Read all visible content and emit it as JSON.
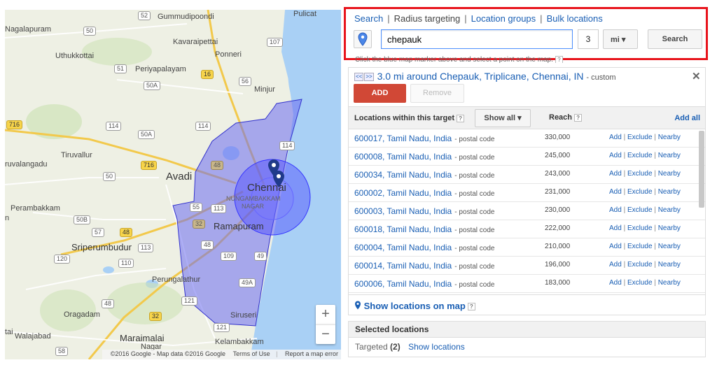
{
  "map": {
    "labels": {
      "pulicat": "Pulicat",
      "gummudipoondi": "Gummudipoondi",
      "nagalapuram": "Nagalapuram",
      "kavaraipettai": "Kavaraipettai",
      "uthukkottai": "Uthukkottai",
      "ponneri": "Ponneri",
      "periyapalayam": "Periyapalayam",
      "minjur": "Minjur",
      "tiruvallur": "Tiruvallur",
      "ruvalangadu": "ruvalangadu",
      "avadi": "Avadi",
      "chennai": "Chennai",
      "nungambakkam": "NUNGAMBAKKAM",
      "nagar": "NAGAR",
      "perambakkam": "Perambakkam",
      "ramapuram": "Ramapuram",
      "sriperumbudur": "Sriperumbudur",
      "perungalathur": "Perungalathur",
      "oragadam": "Oragadam",
      "siruseri": "Siruseri",
      "walajabad": "Walajabad",
      "tai": "tai",
      "maraimalai": "Maraimalai",
      "maraimalai_nagar": "Nagar",
      "kelambakkam": "Kelambakkam",
      "n_left": "n"
    },
    "shields": [
      "52",
      "50",
      "107",
      "51",
      "16",
      "56",
      "50A",
      "716",
      "114",
      "50A",
      "114",
      "48",
      "716",
      "50",
      "114",
      "55",
      "113",
      "32",
      "50B",
      "57",
      "48",
      "48",
      "113",
      "120",
      "110",
      "109",
      "49",
      "49A",
      "48",
      "121",
      "32",
      "121",
      "58"
    ],
    "zoom_in": "+",
    "zoom_out": "−",
    "footer": {
      "copyright": "©2016 Google - Map data ©2016 Google",
      "terms": "Terms of Use",
      "report": "Report a map error"
    },
    "colors": {
      "region_fill": "#6b6bf0",
      "region_stroke": "#3333cc",
      "radius_fill": "#4a4aff"
    }
  },
  "search": {
    "tabs": {
      "search": "Search",
      "radius": "Radius targeting",
      "groups": "Location groups",
      "bulk": "Bulk locations"
    },
    "location_value": "chepauk",
    "radius_value": "3",
    "unit": "mi ▾",
    "button": "Search",
    "hint": "Click the blue map marker above and select a point on the map."
  },
  "target": {
    "prev": "<<",
    "next": ">>",
    "title": "3.0 mi around Chepauk, Triplicane, Chennai, IN",
    "custom": "- custom",
    "close": "✕",
    "add": "ADD",
    "remove": "Remove"
  },
  "locations": {
    "header": "Locations within this target",
    "show_all": "Show all ▾",
    "reach_header": "Reach",
    "add_all": "Add all",
    "help": "?",
    "rows": [
      {
        "name": "600017, Tamil Nadu, India",
        "type": "- postal code",
        "reach": "330,000"
      },
      {
        "name": "600008, Tamil Nadu, India",
        "type": "- postal code",
        "reach": "245,000"
      },
      {
        "name": "600034, Tamil Nadu, India",
        "type": "- postal code",
        "reach": "243,000"
      },
      {
        "name": "600002, Tamil Nadu, India",
        "type": "- postal code",
        "reach": "231,000"
      },
      {
        "name": "600003, Tamil Nadu, India",
        "type": "- postal code",
        "reach": "230,000"
      },
      {
        "name": "600018, Tamil Nadu, India",
        "type": "- postal code",
        "reach": "222,000"
      },
      {
        "name": "600004, Tamil Nadu, India",
        "type": "- postal code",
        "reach": "210,000"
      },
      {
        "name": "600014, Tamil Nadu, India",
        "type": "- postal code",
        "reach": "196,000"
      },
      {
        "name": "600006, Tamil Nadu, India",
        "type": "- postal code",
        "reach": "183,000"
      }
    ],
    "actions": {
      "add": "Add",
      "exclude": "Exclude",
      "nearby": "Nearby",
      "sep": " | "
    },
    "show_on_map": "Show locations on map"
  },
  "selected": {
    "title": "Selected locations",
    "targeted_label": "Targeted",
    "targeted_count": "(2)",
    "show_link": "Show locations"
  },
  "accent": {
    "link": "#1a5fb4",
    "add_button": "#d14836",
    "highlight_border": "#e8141c"
  }
}
